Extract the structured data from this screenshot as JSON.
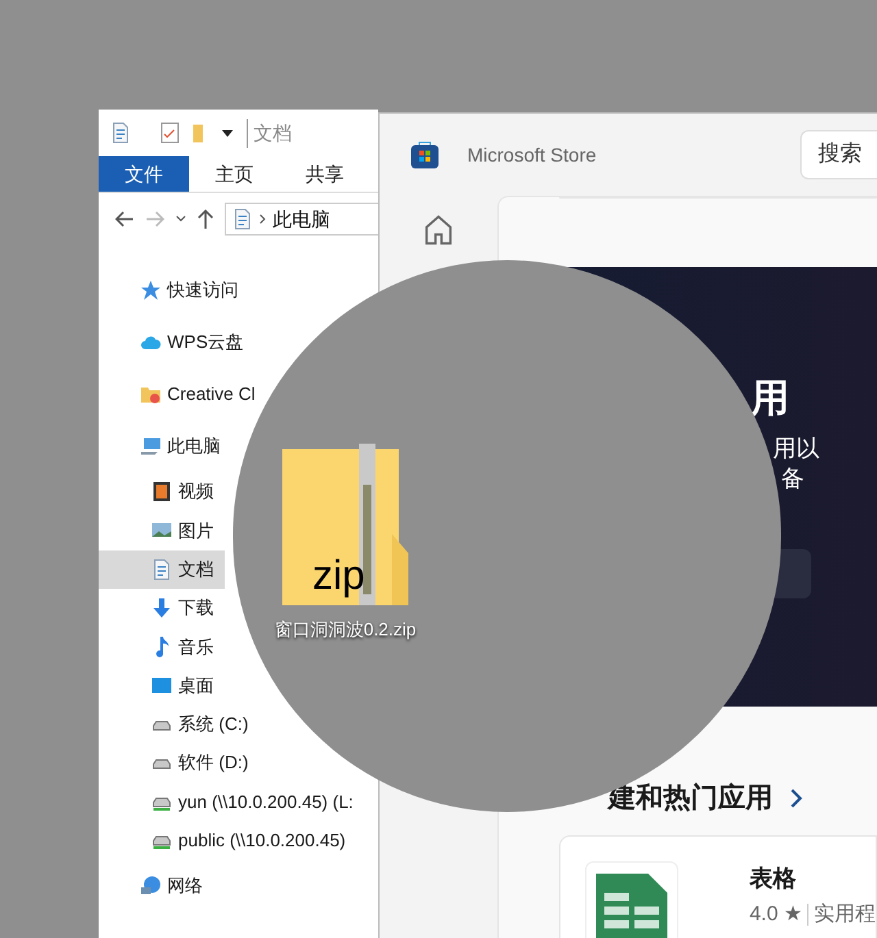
{
  "explorer": {
    "title": "文档",
    "ribbon_tabs": [
      {
        "label": "文件",
        "selected": true
      },
      {
        "label": "主页",
        "selected": false
      },
      {
        "label": "共享",
        "selected": false
      }
    ],
    "address": {
      "path": "此电脑"
    },
    "tree": [
      {
        "label": "快速访问",
        "kind": "star",
        "selected": false
      },
      {
        "label": "WPS云盘",
        "kind": "cloud",
        "selected": false
      },
      {
        "label": "Creative Cl",
        "kind": "folder",
        "selected": false
      },
      {
        "label": "此电脑",
        "kind": "pc",
        "selected": false,
        "children": [
          {
            "label": "视频",
            "kind": "video",
            "selected": false
          },
          {
            "label": "图片",
            "kind": "picture",
            "selected": false
          },
          {
            "label": "文档",
            "kind": "document",
            "selected": true
          },
          {
            "label": "下载",
            "kind": "download",
            "selected": false
          },
          {
            "label": "音乐",
            "kind": "music",
            "selected": false
          },
          {
            "label": "桌面",
            "kind": "desktop",
            "selected": false
          },
          {
            "label": "系统 (C:)",
            "kind": "drive",
            "selected": false
          },
          {
            "label": "软件 (D:)",
            "kind": "drive",
            "selected": false
          },
          {
            "label": "yun (\\\\10.0.200.45) (L:",
            "kind": "netdrive",
            "selected": false
          },
          {
            "label": "public (\\\\10.0.200.45)",
            "kind": "netdrive",
            "selected": false
          }
        ]
      },
      {
        "label": "网络",
        "kind": "network",
        "selected": false
      }
    ]
  },
  "desktop_file": {
    "badge": "zip",
    "name": "窗口洞洞波0.2.zip"
  },
  "store": {
    "title": "Microsoft Store",
    "search": {
      "placeholder": "搜索"
    },
    "hero": {
      "title": "用",
      "lines": [
        "用以",
        "备"
      ]
    },
    "section": {
      "heading": "建和热门应用"
    },
    "app_card": {
      "name": "表格",
      "rating": "4.0 ★",
      "category": "实用程"
    }
  }
}
